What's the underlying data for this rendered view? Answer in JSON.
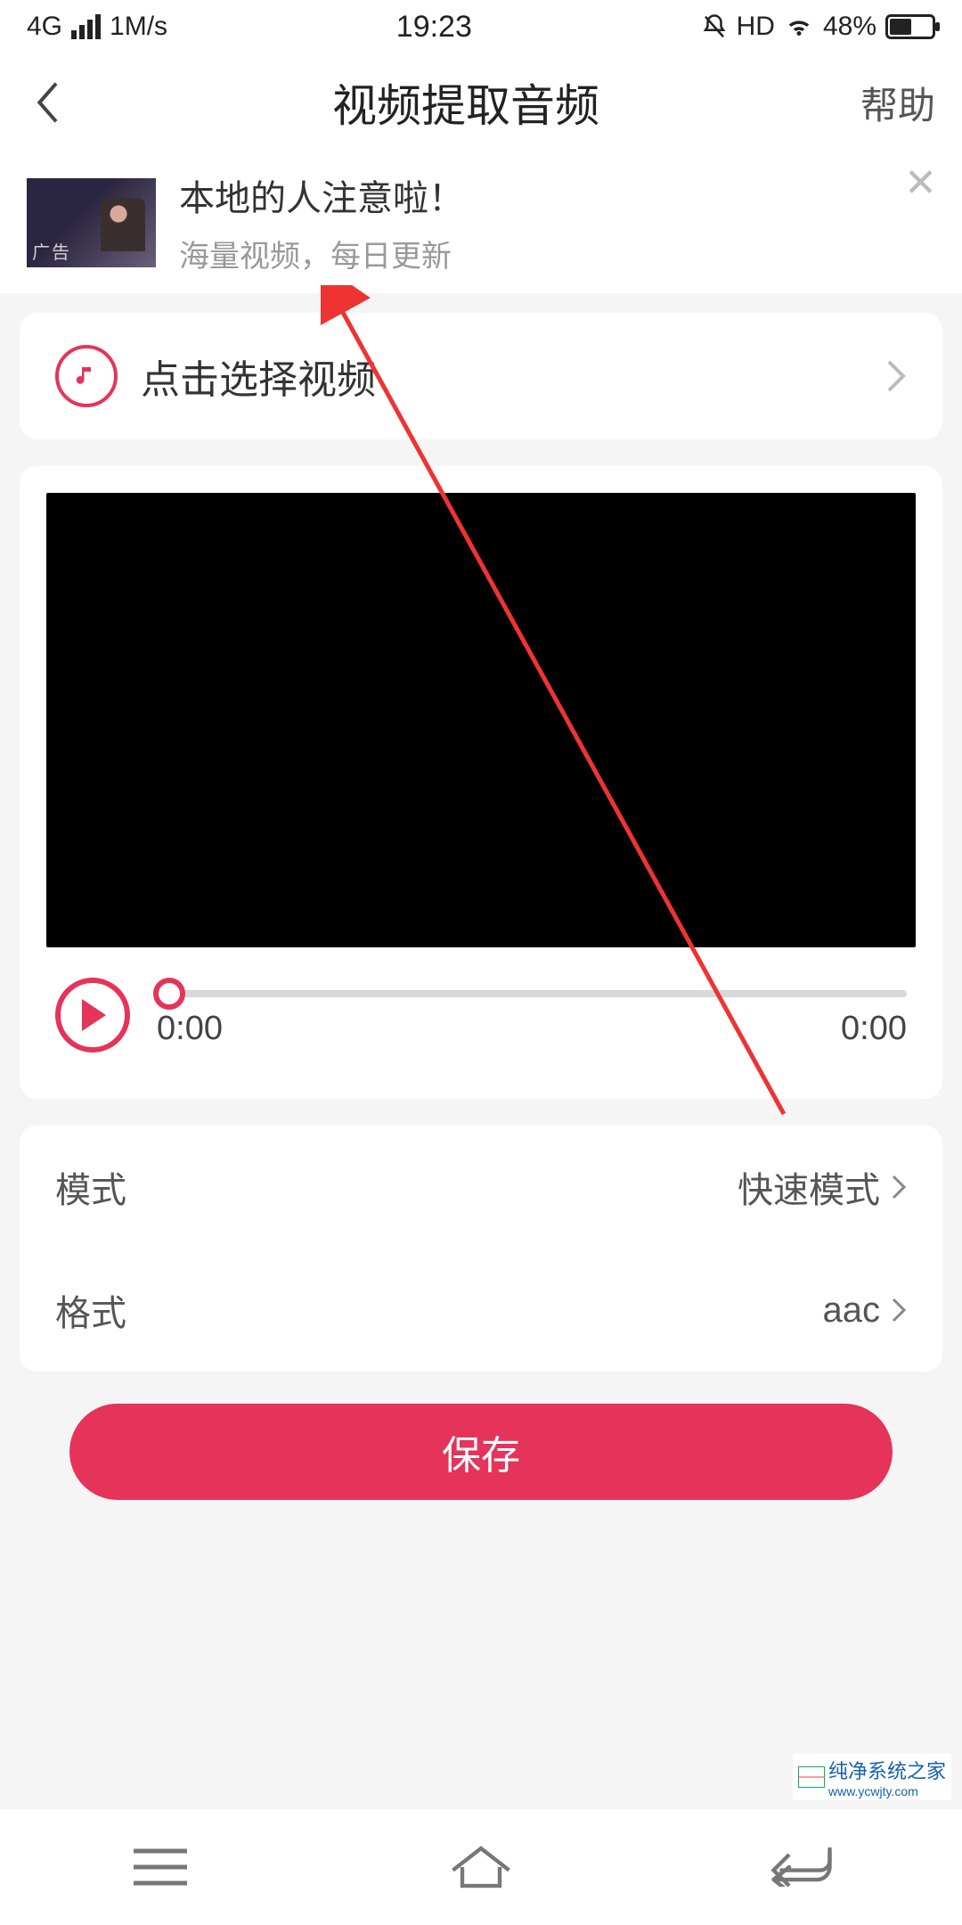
{
  "status": {
    "network": "4G",
    "speed": "1M/s",
    "time": "19:23",
    "hd": "HD",
    "battery_pct": "48%"
  },
  "header": {
    "title": "视频提取音频",
    "help": "帮助"
  },
  "ad": {
    "title": "本地的人注意啦！",
    "subtitle": "海量视频，每日更新",
    "badge": "广告"
  },
  "select": {
    "label": "点击选择视频"
  },
  "player": {
    "current_time": "0:00",
    "total_time": "0:00"
  },
  "settings": {
    "mode_label": "模式",
    "mode_value": "快速模式",
    "format_label": "格式",
    "format_value": "aac"
  },
  "actions": {
    "save": "保存"
  },
  "watermark": {
    "text": "纯净系统之家",
    "url": "www.ycwjty.com"
  }
}
